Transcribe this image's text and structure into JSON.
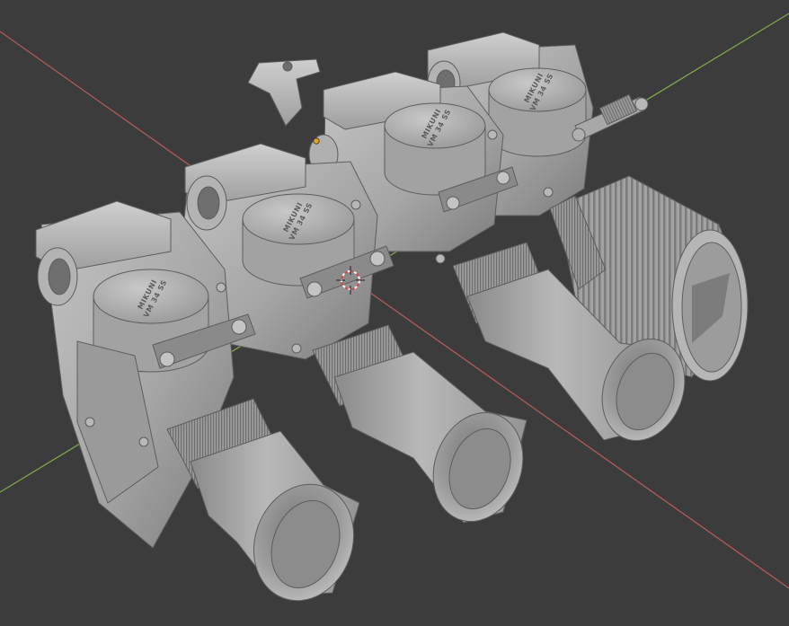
{
  "viewport": {
    "background_color": "#3c3c3c",
    "model_color": "#a9a9a9",
    "axis_x_color": "#b35a5a",
    "axis_y_color": "#7fa64a",
    "origin_marker_color": "#e8a030",
    "cursor_color": "#d44a4a",
    "cursor_name": "3d-cursor-icon"
  },
  "model": {
    "cap_text_line1": "MIKUNI",
    "cap_text_line2": "VM 34 SS"
  }
}
